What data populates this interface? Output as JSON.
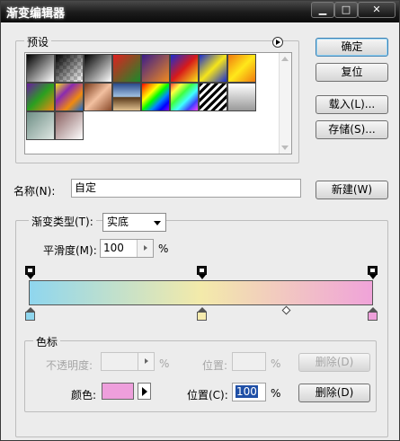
{
  "window": {
    "title": "渐变编辑器",
    "min_label": "▁",
    "max_label": "□",
    "close_label": "✕"
  },
  "presets": {
    "label": "预设",
    "swatches": [
      {
        "name": "foreground-to-background",
        "css": "linear-gradient(135deg,#000,#fff)"
      },
      {
        "name": "foreground-to-transparent",
        "css": "linear-gradient(135deg,#000 0%,rgba(0,0,0,0) 100%), repeating-conic-gradient(#ccc 0% 25%, #fff 0% 50%) 0 0/8px 8px"
      },
      {
        "name": "black-white",
        "css": "linear-gradient(135deg,#000,#fff)"
      },
      {
        "name": "red-green",
        "css": "linear-gradient(135deg,#e02020,#1a8a2a)"
      },
      {
        "name": "violet-orange",
        "css": "linear-gradient(135deg,#3a1d8a,#f08a20)"
      },
      {
        "name": "blue-red-yellow",
        "css": "linear-gradient(135deg,#1a2dd0,#d81a1a,#f8e81a)"
      },
      {
        "name": "blue-yellow-blue",
        "css": "linear-gradient(135deg,#1a2dd0,#f5e51a,#1a2dd0)"
      },
      {
        "name": "orange-yellow-orange",
        "css": "linear-gradient(135deg,#f07a10,#ffe81a,#f07a10)"
      },
      {
        "name": "violet-green-orange",
        "css": "linear-gradient(135deg,#6a1aa0,#2aa020,#f08a10)"
      },
      {
        "name": "yellow-violet-orange-blue",
        "css": "linear-gradient(135deg,#f2e01a,#8a2ab0,#f08a10,#1a6ad0)"
      },
      {
        "name": "copper",
        "css": "linear-gradient(135deg,#7a3a1a,#f2c0a0,#8a4a2a)"
      },
      {
        "name": "chrome",
        "css": "linear-gradient(180deg,#2a4a8a 0%,#a0c0e0 48%,#5a3a1a 52%,#e0c090 100%)"
      },
      {
        "name": "spectrum",
        "css": "linear-gradient(135deg,#ff0000,#ff8800,#ffff00,#00ff00,#0088ff,#0000ff,#8800ff)"
      },
      {
        "name": "transparent-rainbow",
        "css": "linear-gradient(135deg,#ff4040,#ffff40,#40ff40,#40ffff,#4040ff,#ff40ff)"
      },
      {
        "name": "transparent-stripes",
        "css": "repeating-linear-gradient(135deg,#000 0 3px,#fff 3px 6px)"
      },
      {
        "name": "neutral-density",
        "css": "linear-gradient(180deg,#fff,#999)"
      },
      {
        "name": "silver-green",
        "css": "linear-gradient(135deg,#6f8f86,#dfe7e3)"
      },
      {
        "name": "pale-pink",
        "css": "linear-gradient(135deg,#8a6060,#ffffff)"
      }
    ]
  },
  "buttons": {
    "ok": "确定",
    "reset": "复位",
    "load": "载入(L)...",
    "save": "存储(S)...",
    "new": "新建(W)",
    "delete_disabled": "删除(D)",
    "delete": "删除(D)"
  },
  "name_field": {
    "label": "名称(N):",
    "value": "自定"
  },
  "gradient": {
    "type_label": "渐变类型(T):",
    "type_value": "实底",
    "smoothness_label": "平滑度(M):",
    "smoothness_value": "100",
    "percent": "%",
    "colors": [
      "#8fd6ee",
      "#f6ebae",
      "#eea0da"
    ],
    "bar_css": "linear-gradient(90deg,#8fd6ee 0%,#f3eaaa 50%,#f0a3d9 100%)",
    "midpoint_position": 0.75
  },
  "stops_group": {
    "label": "色标",
    "opacity_label": "不透明度:",
    "opacity_value": "",
    "position_label_disabled": "位置:",
    "position_value_disabled": "",
    "color_label": "颜色:",
    "color_value": "#ee9fdc",
    "position_label": "位置(C):",
    "position_value": "100",
    "percent": "%"
  }
}
